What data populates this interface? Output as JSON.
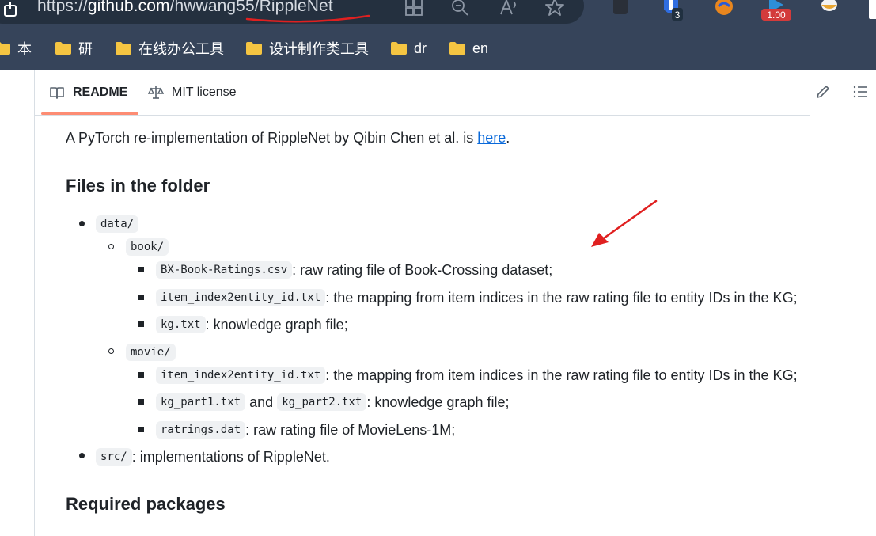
{
  "browser": {
    "url_prefix": "https://",
    "url_host": "github.com",
    "url_path": "/hwwang55/RippleNet",
    "extensions": {
      "badge_count": "3",
      "badge_speed": "1.00"
    }
  },
  "bookmarks": [
    {
      "label": "本"
    },
    {
      "label": "研"
    },
    {
      "label": "在线办公工具"
    },
    {
      "label": "设计制作类工具"
    },
    {
      "label": "dr"
    },
    {
      "label": "en"
    }
  ],
  "tabs": {
    "readme": "README",
    "license": "MIT license"
  },
  "readme": {
    "intro_text": "A PyTorch re-implementation of RippleNet by Qibin Chen et al. is ",
    "intro_link": "here",
    "intro_end": ".",
    "heading_files": "Files in the folder",
    "heading_packages": "Required packages",
    "items": {
      "data": "data/",
      "book": "book/",
      "book_ratings_code": "BX-Book-Ratings.csv",
      "book_ratings_desc": ": raw rating file of Book-Crossing dataset;",
      "book_index_code": "item_index2entity_id.txt",
      "book_index_desc": ": the mapping from item indices in the raw rating file to entity IDs in the KG;",
      "book_kg_code": "kg.txt",
      "book_kg_desc": ": knowledge graph file;",
      "movie": "movie/",
      "movie_index_code": "item_index2entity_id.txt",
      "movie_index_desc": ": the mapping from item indices in the raw rating file to entity IDs in the KG;",
      "movie_kg1_code": "kg_part1.txt",
      "movie_and": "and",
      "movie_kg2_code": "kg_part2.txt",
      "movie_kg_desc": ": knowledge graph file;",
      "movie_ratings_code": "ratrings.dat",
      "movie_ratings_desc": ": raw rating file of MovieLens-1M;",
      "src_code": "src/",
      "src_desc": ": implementations of RippleNet."
    }
  },
  "colors": {
    "chrome_bg": "#36445a",
    "link": "#0969da",
    "tab_accent": "#fd8c73",
    "annotation": "#e02020"
  }
}
